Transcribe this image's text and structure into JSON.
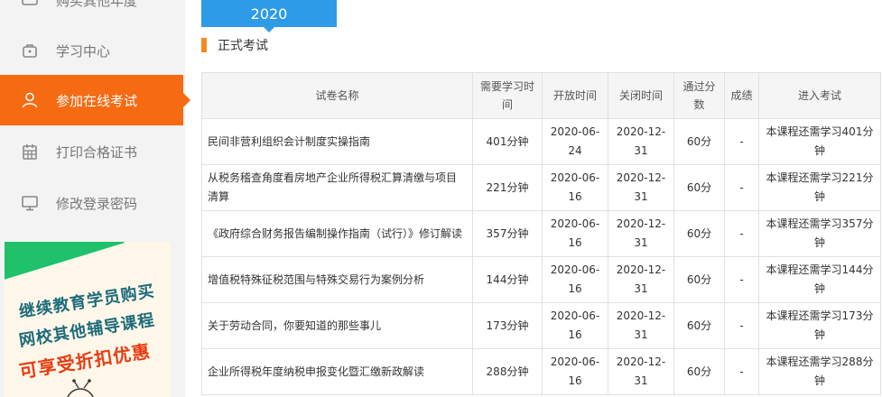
{
  "sidebar": {
    "items": [
      {
        "label": "购买其他年度",
        "icon": "cart-icon"
      },
      {
        "label": "学习中心",
        "icon": "bag-icon"
      },
      {
        "label": "参加在线考试",
        "icon": "user-icon"
      },
      {
        "label": "打印合格证书",
        "icon": "calendar-icon"
      },
      {
        "label": "修改登录密码",
        "icon": "monitor-icon"
      }
    ],
    "active_color": "#f66a12",
    "promo": {
      "line1": "继续教育学员购买",
      "line2": "网校其他辅导课程",
      "line3": "可享受折扣优惠"
    }
  },
  "year_tab": "2020",
  "section_title": "正式考试",
  "table": {
    "headers": [
      "试卷名称",
      "需要学习时间",
      "开放时间",
      "关闭时间",
      "通过分数",
      "成绩",
      "进入考试"
    ],
    "rows": [
      {
        "name": "民间非营利组织会计制度实操指南",
        "study": "401分钟",
        "open": "2020-06-24",
        "close": "2020-12-31",
        "pass": "60分",
        "score": "-",
        "action": "本课程还需学习401分钟"
      },
      {
        "name": "从税务稽查角度看房地产企业所得税汇算清缴与项目清算",
        "study": "221分钟",
        "open": "2020-06-16",
        "close": "2020-12-31",
        "pass": "60分",
        "score": "-",
        "action": "本课程还需学习221分钟"
      },
      {
        "name": "《政府综合财务报告编制操作指南（试行）》修订解读",
        "study": "357分钟",
        "open": "2020-06-16",
        "close": "2020-12-31",
        "pass": "60分",
        "score": "-",
        "action": "本课程还需学习357分钟"
      },
      {
        "name": "增值税特殊征税范围与特殊交易行为案例分析",
        "study": "144分钟",
        "open": "2020-06-16",
        "close": "2020-12-31",
        "pass": "60分",
        "score": "-",
        "action": "本课程还需学习144分钟"
      },
      {
        "name": "关于劳动合同，你要知道的那些事儿",
        "study": "173分钟",
        "open": "2020-06-16",
        "close": "2020-12-31",
        "pass": "60分",
        "score": "-",
        "action": "本课程还需学习173分钟"
      },
      {
        "name": "企业所得税年度纳税申报变化暨汇缴新政解读",
        "study": "288分钟",
        "open": "2020-06-16",
        "close": "2020-12-31",
        "pass": "60分",
        "score": "-",
        "action": "本课程还需学习288分钟"
      }
    ]
  }
}
